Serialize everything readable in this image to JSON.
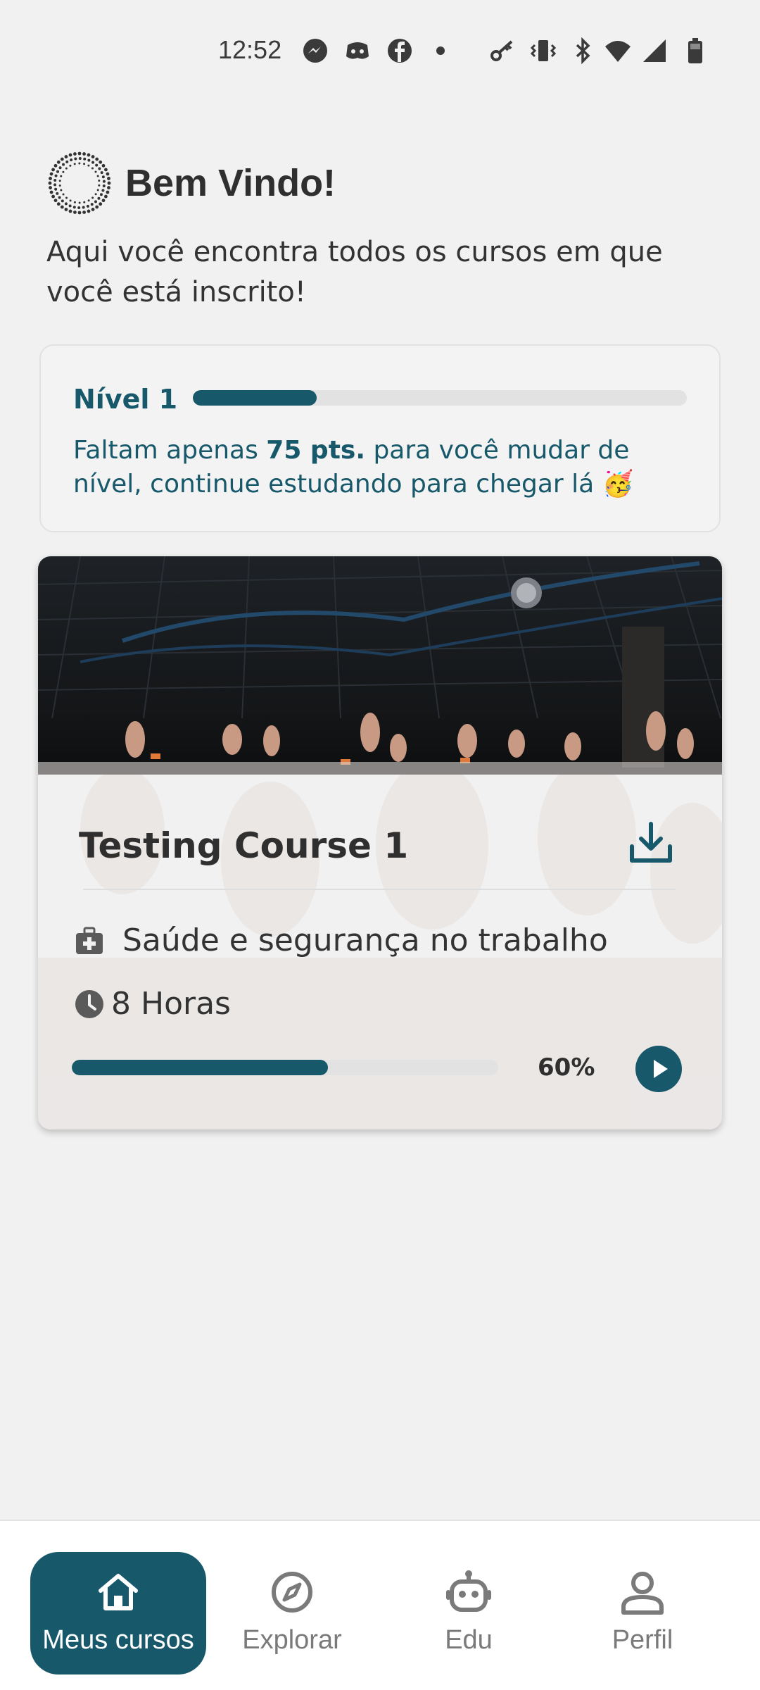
{
  "status_bar": {
    "time": "12:52",
    "icons": [
      "messenger-icon",
      "discord-icon",
      "facebook-icon",
      "dot-icon",
      "key-icon",
      "vibrate-icon",
      "bluetooth-icon",
      "wifi-icon",
      "signal-icon",
      "battery-icon"
    ]
  },
  "header": {
    "title": "Bem Vindo!",
    "subtitle": "Aqui você encontra todos os cursos em que você está inscrito!"
  },
  "level": {
    "label": "Nível 1",
    "progress_fraction": 0.25,
    "text_before": "Faltam apenas ",
    "points": "75 pts.",
    "text_after": " para você mudar de nível, continue estudando para chegar lá 🥳"
  },
  "course": {
    "title": "Testing Course 1",
    "category": "Saúde e segurança no trabalho",
    "hours": "8 Horas",
    "progress_fraction": 0.6,
    "progress_label": "60%"
  },
  "bottom_nav": [
    {
      "label": "Meus cursos",
      "icon": "home-icon",
      "active": true
    },
    {
      "label": "Explorar",
      "icon": "compass-icon",
      "active": false
    },
    {
      "label": "Edu",
      "icon": "robot-icon",
      "active": false
    },
    {
      "label": "Perfil",
      "icon": "person-icon",
      "active": false
    }
  ],
  "colors": {
    "primary": "#17586a",
    "background": "#f1f1f1",
    "track": "#e2e2e2"
  }
}
